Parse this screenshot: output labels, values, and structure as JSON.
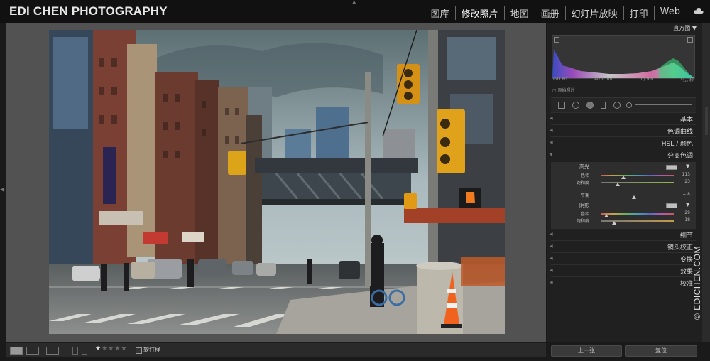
{
  "app": {
    "brand": "EDI CHEN PHOTOGRAPHY",
    "modules": [
      "图库",
      "修改照片",
      "地图",
      "画册",
      "幻灯片放映",
      "打印",
      "Web"
    ],
    "active_module": "修改照片",
    "watermark": "© EDICHEN.COM"
  },
  "histogram": {
    "title": "直方图 ▼",
    "iso": "ISO 80",
    "focal": "40.1 mm",
    "aperture": "f / 9.0",
    "shutter": "¹⁄₁₂₅ 秒",
    "original_label": "原始照片"
  },
  "panels": {
    "basic": "基本",
    "tone_curve": "色调曲线",
    "hsl": "HSL / 颜色",
    "split_toning": "分离色调",
    "detail": "细节",
    "lens": "镜头校正",
    "transform": "变换",
    "effects": "效果",
    "calibration": "校准"
  },
  "split_toning": {
    "highlights_label": "高光",
    "shadows_label": "阴影",
    "hue_label": "色相",
    "sat_label": "饱和度",
    "balance_label": "平衡",
    "highlights_hue": 113,
    "highlights_sat": 23,
    "balance": -8,
    "shadows_hue": 29,
    "shadows_sat": 18,
    "highlights_hue_text": "113",
    "highlights_sat_text": "23",
    "balance_text": "− 8",
    "shadows_hue_text": "29",
    "shadows_sat_text": "18"
  },
  "toolbar": {
    "prev_label": "上一张",
    "reset_label": "复位",
    "soft_proof_label": "软打样",
    "rating": 1,
    "rating_max": 5
  },
  "icons": [
    "cloud-icon",
    "crop-icon",
    "spot-removal-icon",
    "red-eye-icon",
    "graduated-filter-icon",
    "radial-filter-icon",
    "adjustment-brush-icon",
    "loupe-view-icon",
    "compare-view-icon"
  ]
}
